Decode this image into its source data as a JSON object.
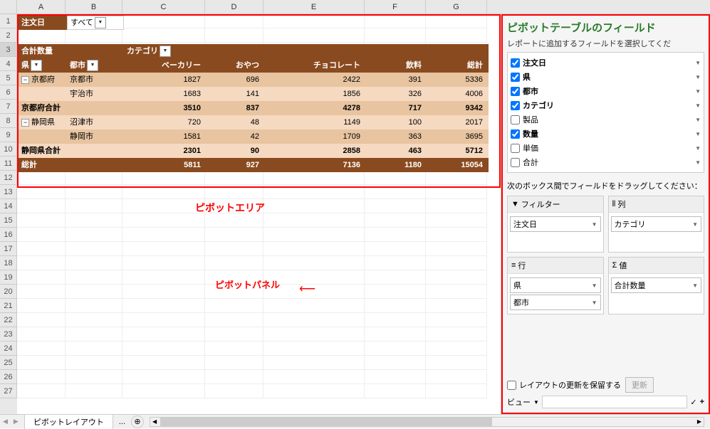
{
  "columns": [
    "A",
    "B",
    "C",
    "D",
    "E",
    "F",
    "G"
  ],
  "rowNums": [
    "1",
    "2",
    "3",
    "4",
    "5",
    "6",
    "7",
    "8",
    "9",
    "10",
    "11",
    "12",
    "13",
    "14",
    "15",
    "16",
    "17",
    "18",
    "19",
    "20",
    "21",
    "22",
    "23",
    "24",
    "25",
    "26",
    "27"
  ],
  "filter": {
    "label": "注文日",
    "value": "すべて"
  },
  "p": {
    "measure": "合計数量",
    "catHdr": "カテゴリ",
    "rowHdr1": "県",
    "rowHdr2": "都市",
    "cols": [
      "ベーカリー",
      "おやつ",
      "チョコレート",
      "飲料",
      "総計"
    ],
    "r1": {
      "pref": "京都府",
      "city": "京都市",
      "v": [
        "1827",
        "696",
        "2422",
        "391",
        "5336"
      ]
    },
    "r2": {
      "city": "宇治市",
      "v": [
        "1683",
        "141",
        "1856",
        "326",
        "4006"
      ]
    },
    "t1": {
      "label": "京都府合計",
      "v": [
        "3510",
        "837",
        "4278",
        "717",
        "9342"
      ]
    },
    "r3": {
      "pref": "静岡県",
      "city": "沼津市",
      "v": [
        "720",
        "48",
        "1149",
        "100",
        "2017"
      ]
    },
    "r4": {
      "city": "静岡市",
      "v": [
        "1581",
        "42",
        "1709",
        "363",
        "3695"
      ]
    },
    "t2": {
      "label": "静岡県合計",
      "v": [
        "2301",
        "90",
        "2858",
        "463",
        "5712"
      ]
    },
    "gt": {
      "label": "総計",
      "v": [
        "5811",
        "927",
        "7136",
        "1180",
        "15054"
      ]
    }
  },
  "labels": {
    "pivotArea": "ピボットエリア",
    "pivotPanel": "ピボットパネル"
  },
  "panel": {
    "title": "ピボットテーブルのフィールド",
    "sub": "レポートに追加するフィールドを選択してくだ",
    "fields": [
      {
        "name": "注文日",
        "checked": true
      },
      {
        "name": "県",
        "checked": true
      },
      {
        "name": "都市",
        "checked": true
      },
      {
        "name": "カテゴリ",
        "checked": true
      },
      {
        "name": "製品",
        "checked": false
      },
      {
        "name": "数量",
        "checked": true
      },
      {
        "name": "単価",
        "checked": false
      },
      {
        "name": "合計",
        "checked": false
      }
    ],
    "dragMsg": "次のボックス間でフィールドをドラッグしてください：",
    "zFilter": "フィルター",
    "zCol": "列",
    "zRow": "行",
    "zVal": "値",
    "filterItems": [
      "注文日"
    ],
    "colItems": [
      "カテゴリ"
    ],
    "rowItems": [
      "県",
      "都市"
    ],
    "valItems": [
      "合計数量"
    ],
    "defer": "レイアウトの更新を保留する",
    "update": "更新",
    "view": "ビュー"
  },
  "tab": {
    "name": "ピボットレイアウト",
    "more": "..."
  }
}
